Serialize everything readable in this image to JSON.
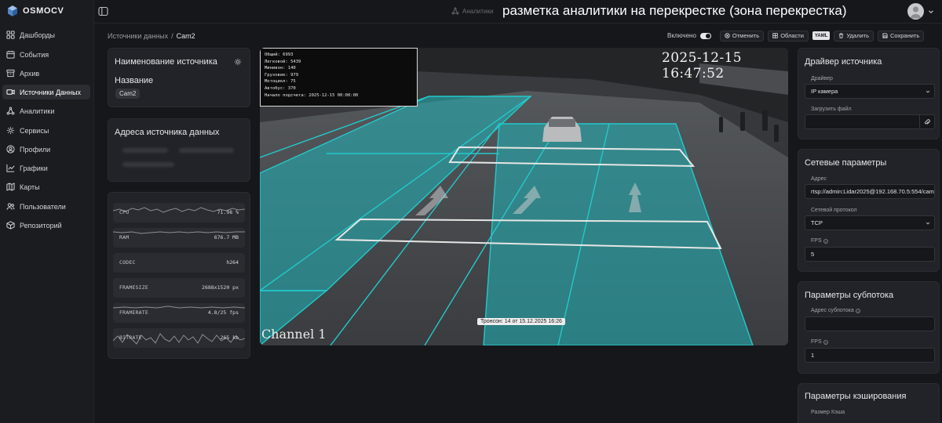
{
  "app": {
    "logo_text": "OSMOCV"
  },
  "sidebar": {
    "items": [
      {
        "label": "Дашборды",
        "icon": "grid-icon"
      },
      {
        "label": "События",
        "icon": "calendar-icon"
      },
      {
        "label": "Архив",
        "icon": "archive-icon"
      },
      {
        "label": "Источники Данных",
        "icon": "camera-icon",
        "active": true
      },
      {
        "label": "Аналитики",
        "icon": "analytics-icon"
      },
      {
        "label": "Сервисы",
        "icon": "services-icon"
      },
      {
        "label": "Профили",
        "icon": "profile-icon"
      },
      {
        "label": "Графики",
        "icon": "chart-icon"
      },
      {
        "label": "Карты",
        "icon": "map-icon"
      },
      {
        "label": "Пользователи",
        "icon": "users-icon"
      },
      {
        "label": "Репозиторий",
        "icon": "box-icon"
      }
    ]
  },
  "topbar": {
    "analytics_label": "Аналитики",
    "overlay_caption": "разметка аналитики на перекрестке (зона перекрестка)"
  },
  "breadcrumb": {
    "parent": "Источники данных",
    "separator": "/",
    "current": "Cam2"
  },
  "toolbar": {
    "enabled_label": "Включено",
    "cancel_label": "Отменить",
    "areas_label": "Области",
    "yaml_label": "YAML",
    "delete_label": "Удалить",
    "save_label": "Сохранить"
  },
  "source_name_card": {
    "title": "Наименование источника",
    "name_label": "Название",
    "name_value": "Cam2"
  },
  "source_address_card": {
    "title": "Адреса источника данных"
  },
  "metrics": [
    {
      "name": "CPU",
      "value": "71.98 %",
      "spark": true
    },
    {
      "name": "RAM",
      "value": "676.7 MB",
      "spark": true
    },
    {
      "name": "CODEC",
      "value": "h264",
      "spark": false
    },
    {
      "name": "FRAMESIZE",
      "value": "2688x1520 px",
      "spark": false
    },
    {
      "name": "FRAMERATE",
      "value": "4.8/25 fps",
      "spark": true
    },
    {
      "name": "BITRATE",
      "value": "265 kb",
      "spark": true
    }
  ],
  "video": {
    "stats": [
      "Общий: 6993",
      "Легковой: 5439",
      "Минивэн: 140",
      "Грузовик: 979",
      "Мотоцикл: 75",
      "Автобус: 370",
      "Начало подсчета: 2025-12-15 00:00:00"
    ],
    "osd_time": "2025-12-15 16:47:52",
    "osd_channel": "Channel 1",
    "zone_tooltip": "Тронсон: 14 от 15.12.2025 16:26",
    "zone_color": "#1fb5b8"
  },
  "driver_card": {
    "title": "Драйвер источника",
    "driver_label": "Драйвер",
    "driver_value": "IP камера",
    "upload_label": "Загрузить файл",
    "upload_value": ""
  },
  "network_card": {
    "title": "Сетевые параметры",
    "address_label": "Адрес",
    "address_value": "rtsp://admin:Lidar2025@192.168.70.5:554/cam",
    "protocol_label": "Сетевой протокол",
    "protocol_value": "TCP",
    "fps_label": "FPS",
    "fps_value": "5"
  },
  "substream_card": {
    "title": "Параметры субпотока",
    "address_label": "Адрес субпотока",
    "address_value": "",
    "fps_label": "FPS",
    "fps_value": "1"
  },
  "cache_card": {
    "title": "Параметры кэширования",
    "size_label": "Размер Кэша"
  }
}
